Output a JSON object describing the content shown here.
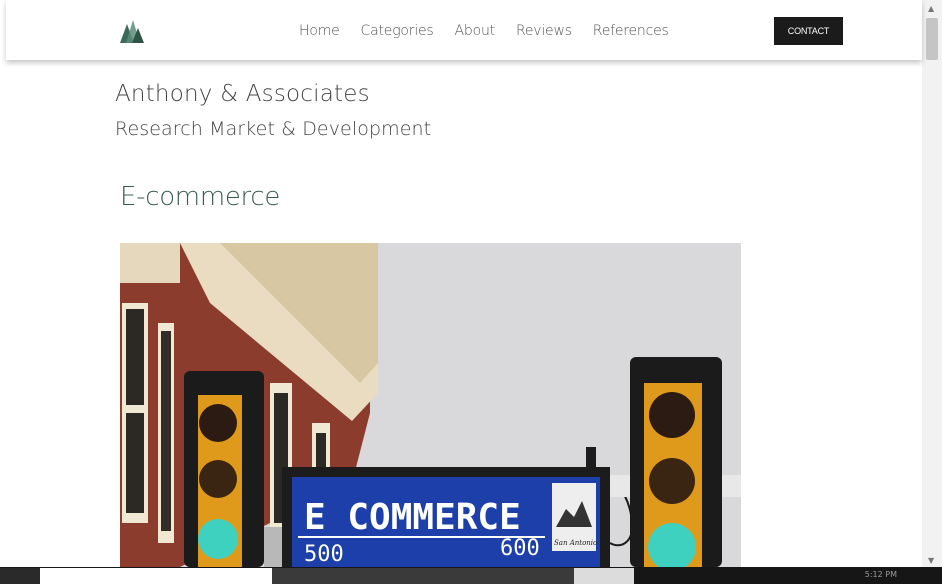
{
  "nav": {
    "logo": "AA-logo",
    "links": [
      "Home",
      "Categories",
      "About",
      "Reviews",
      "References"
    ],
    "contact_label": "CONTACT"
  },
  "header": {
    "title": "Anthony & Associates",
    "subtitle": "Research Market & Development"
  },
  "main": {
    "heading": "E-commerce",
    "image": {
      "sign_text": "E COMMERCE",
      "block_left": "500",
      "block_right": "600",
      "seal_text": "San Antonio"
    }
  },
  "taskbar": {
    "clock": "5:12 PM"
  },
  "colors": {
    "accent_green": "#3c5b4e",
    "contact_bg": "#1b1b1b",
    "sign_blue": "#1c3faa"
  }
}
